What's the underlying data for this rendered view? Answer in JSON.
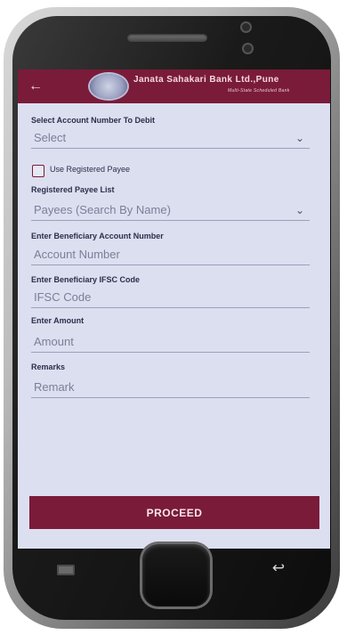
{
  "app": {
    "bank_name": "Janata Sahakari Bank Ltd.,Pune",
    "bank_subtitle": "Multi-State Scheduled Bank"
  },
  "form": {
    "debit_account": {
      "label": "Select Account Number To Debit",
      "value": "Select"
    },
    "use_registered_payee": {
      "label": "Use Registered Payee",
      "checked": false
    },
    "payee_list": {
      "label": "Registered Payee List",
      "placeholder": "Payees (Search By Name)"
    },
    "beneficiary_account": {
      "label": "Enter Beneficiary Account Number",
      "placeholder": "Account Number"
    },
    "ifsc": {
      "label": "Enter Beneficiary IFSC Code",
      "placeholder": "IFSC Code"
    },
    "amount": {
      "label": "Enter Amount",
      "placeholder": "Amount"
    },
    "remarks": {
      "label": "Remarks",
      "placeholder": "Remark"
    }
  },
  "actions": {
    "proceed_label": "PROCEED"
  },
  "icons": {
    "back": "back-arrow-icon",
    "dropdown": "chevron-down-icon",
    "hardware_back": "return-icon"
  },
  "colors": {
    "accent": "#7a1b3a",
    "screen_bg": "#dcdff0"
  }
}
